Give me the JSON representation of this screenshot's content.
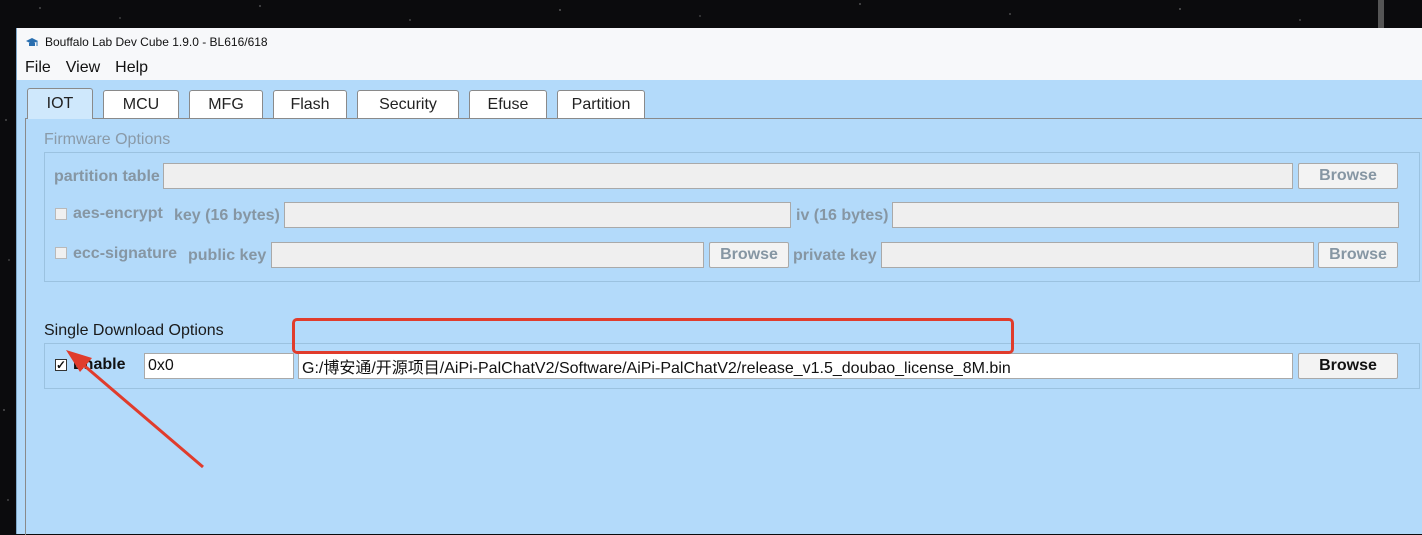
{
  "window": {
    "title": "Bouffalo Lab Dev Cube 1.9.0 - BL616/618"
  },
  "menu": [
    {
      "label": "File"
    },
    {
      "label": "View"
    },
    {
      "label": "Help"
    }
  ],
  "tabs": [
    {
      "label": "IOT",
      "active": true
    },
    {
      "label": "MCU"
    },
    {
      "label": "MFG"
    },
    {
      "label": "Flash"
    },
    {
      "label": "Security"
    },
    {
      "label": "Efuse"
    },
    {
      "label": "Partition"
    }
  ],
  "firmware_options": {
    "title": "Firmware Options",
    "partition_table_label": "partition table",
    "partition_table_value": "",
    "browse_label": "Browse",
    "aes_encrypt_label": "aes-encrypt",
    "key_label": "key (16 bytes)",
    "key_value": "",
    "iv_label": "iv (16 bytes)",
    "iv_value": "",
    "ecc_signature_label": "ecc-signature",
    "public_key_label": "public key",
    "public_key_value": "",
    "private_key_label": "private key",
    "private_key_value": ""
  },
  "single_download": {
    "title": "Single Download Options",
    "enable_label": "Enable",
    "enable_checked": true,
    "address_value": "0x0",
    "file_path_value": "G:/博安通/开源项目/AiPi-PalChatV2/Software/AiPi-PalChatV2/release_v1.5_doubao_license_8M.bin",
    "browse_label": "Browse"
  },
  "colors": {
    "background": "#b3dafa",
    "annotation": "#e03c2c"
  }
}
